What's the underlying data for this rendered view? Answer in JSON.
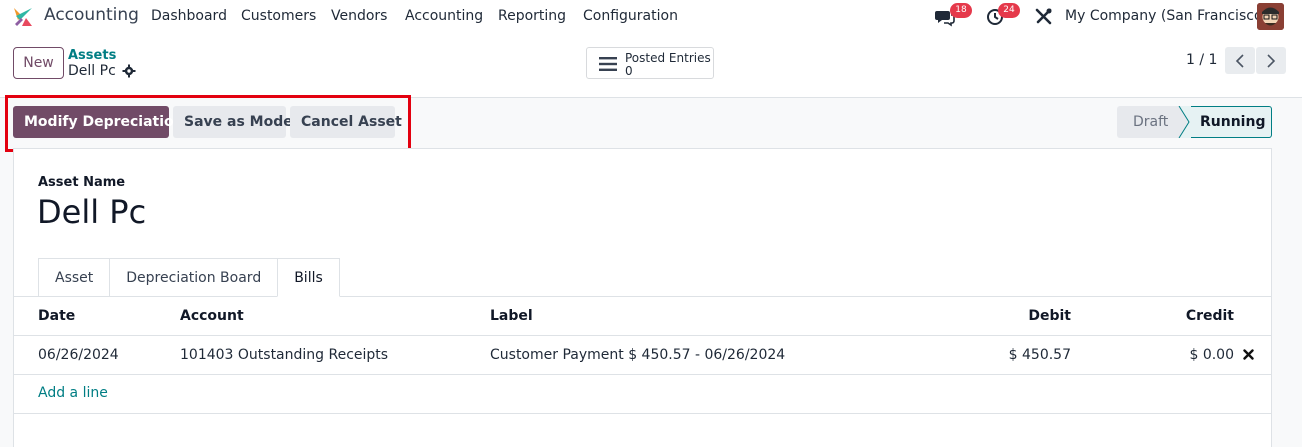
{
  "navbar": {
    "app_name": "Accounting",
    "menu": [
      "Dashboard",
      "Customers",
      "Vendors",
      "Accounting",
      "Reporting",
      "Configuration"
    ],
    "messages_count": "18",
    "activities_count": "24",
    "company": "My Company (San Francisco)"
  },
  "control_panel": {
    "new_label": "New",
    "breadcrumb": "Assets",
    "record_title": "Dell Pc",
    "smart_button": {
      "label": "Posted Entries",
      "value": "0"
    },
    "pager": "1 / 1"
  },
  "actions": {
    "modify_depreciation": "Modify Depreciation",
    "save_as_model": "Save as Model",
    "cancel_asset": "Cancel Asset"
  },
  "status": {
    "draft": "Draft",
    "running": "Running"
  },
  "form": {
    "asset_name_label": "Asset Name",
    "asset_name": "Dell Pc",
    "tabs": [
      "Asset",
      "Depreciation Board",
      "Bills"
    ],
    "table": {
      "headers": {
        "date": "Date",
        "account": "Account",
        "label": "Label",
        "debit": "Debit",
        "credit": "Credit"
      },
      "rows": [
        {
          "date": "06/26/2024",
          "account": "101403 Outstanding Receipts",
          "label": "Customer Payment $ 450.57 - 06/26/2024",
          "debit": "$ 450.57",
          "credit": "$ 0.00"
        }
      ],
      "add_line": "Add a line"
    }
  },
  "colors": {
    "primary": "#714b67",
    "teal": "#017e84",
    "highlight_red": "#e3000f",
    "badge_red": "#e5394b"
  }
}
